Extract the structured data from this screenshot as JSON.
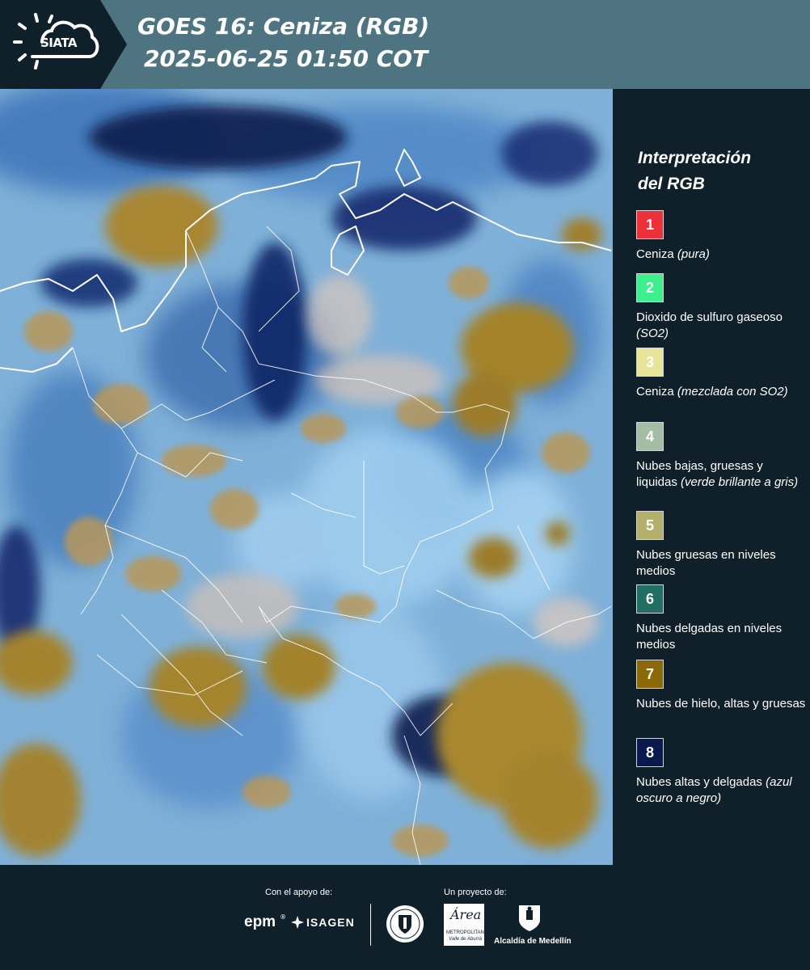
{
  "header": {
    "logo_text": "SIATA",
    "title_line1": "GOES 16: Ceniza (RGB)",
    "title_line2": "2025-06-25 01:50 COT"
  },
  "legend": {
    "title_line1": "Interpretación",
    "title_line2": "del RGB",
    "items": [
      {
        "number": "1",
        "color": "#ee3139",
        "text_color": "#ffffff",
        "label": "Ceniza",
        "note": "(pura)"
      },
      {
        "number": "2",
        "color": "#3ef08d",
        "text_color": "#ffffff",
        "label": "Dioxido de sulfuro gaseoso",
        "note": "(SO2)"
      },
      {
        "number": "3",
        "color": "#e8e59a",
        "text_color": "#ffffff",
        "label": "Ceniza",
        "note": "(mezclada con SO2)"
      },
      {
        "number": "4",
        "color": "#a4bda4",
        "text_color": "#ffffff",
        "label": "Nubes bajas, gruesas y liquidas",
        "note": "(verde brillante a gris)"
      },
      {
        "number": "5",
        "color": "#b3b06e",
        "text_color": "#ffffff",
        "label": "Nubes gruesas en niveles medios",
        "note": ""
      },
      {
        "number": "6",
        "color": "#216f63",
        "text_color": "#ffffff",
        "label": "Nubes delgadas en niveles medios",
        "note": ""
      },
      {
        "number": "7",
        "color": "#8a6a07",
        "text_color": "#ffffff",
        "label": "Nubes de hielo, altas y gruesas",
        "note": ""
      },
      {
        "number": "8",
        "color": "#0b1a4e",
        "text_color": "#ffffff",
        "label": "Nubes altas y delgadas",
        "note": "(azul oscuro a negro)"
      }
    ]
  },
  "footer": {
    "support_caption": "Con el apoyo de:",
    "project_caption": "Un proyecto de:",
    "sponsor_epm": "epm",
    "sponsor_isagen": "ISAGEN",
    "area_logo_word": "Área",
    "area_name": "METROPOLITANA",
    "area_sub": "Valle de Aburrá",
    "alcaldia_name": "Alcaldía de Medellín"
  },
  "colors": {
    "header_band": "#4f7481",
    "dark_background": "#0f202a",
    "ocean_light_blue": "#7fb0d8",
    "ice_cloud_brown": "#a17f2a",
    "thin_cloud_navy": "#0b1a4e",
    "border_lines": "#ffffff"
  },
  "icons": [
    "siata-sun-cloud-logo",
    "epm-logo",
    "isagen-logo",
    "university-seal-logo",
    "area-metropolitana-logo",
    "alcaldia-medellin-shield-logo"
  ]
}
